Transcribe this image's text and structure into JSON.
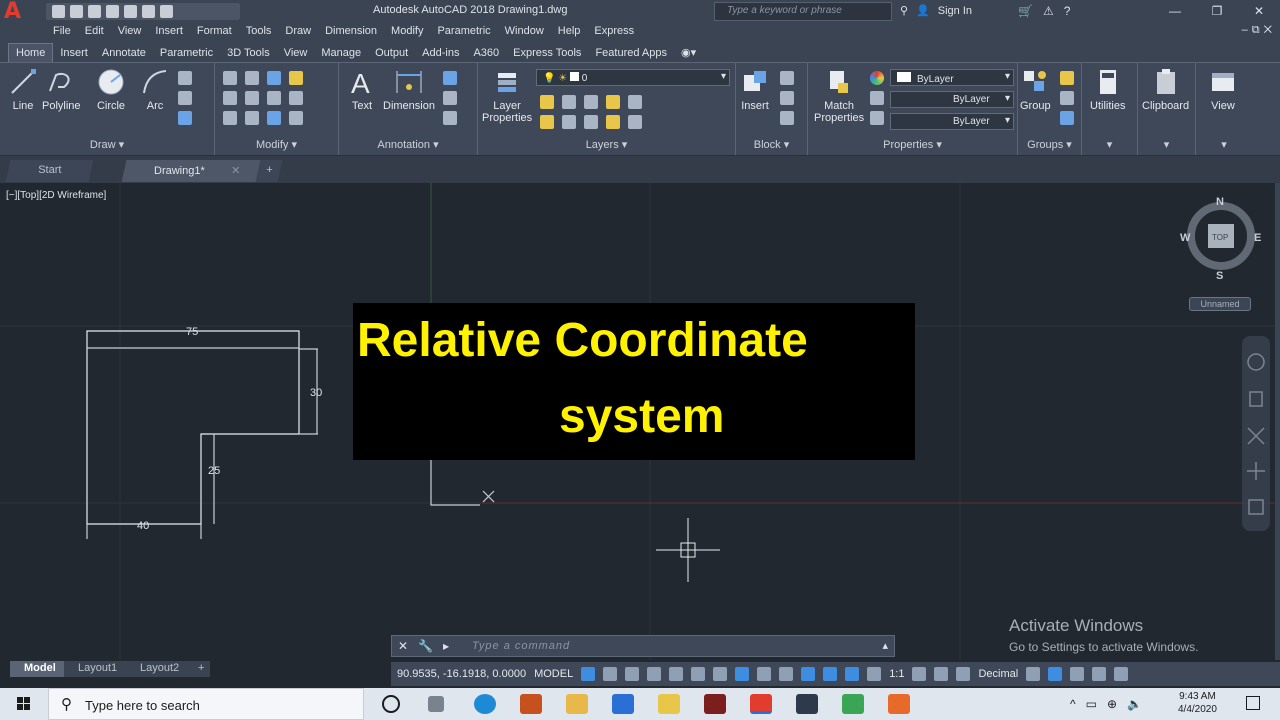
{
  "app": {
    "logo_letter": "A",
    "window_title": "Autodesk AutoCAD 2018    Drawing1.dwg",
    "search_placeholder": "Type a keyword or phrase",
    "sign_in": "Sign In"
  },
  "menu": [
    "File",
    "Edit",
    "View",
    "Insert",
    "Format",
    "Tools",
    "Draw",
    "Dimension",
    "Modify",
    "Parametric",
    "Window",
    "Help",
    "Express"
  ],
  "ribbon_tabs": [
    "Home",
    "Insert",
    "Annotate",
    "Parametric",
    "3D Tools",
    "View",
    "Manage",
    "Output",
    "Add-ins",
    "A360",
    "Express Tools",
    "Featured Apps"
  ],
  "ribbon": {
    "draw": {
      "title": "Draw",
      "line": "Line",
      "polyline": "Polyline",
      "circle": "Circle",
      "arc": "Arc"
    },
    "modify": {
      "title": "Modify"
    },
    "annotation": {
      "title": "Annotation",
      "text": "Text",
      "dimension": "Dimension"
    },
    "layers": {
      "title": "Layers",
      "layer_properties_1": "Layer",
      "layer_properties_2": "Properties",
      "current_layer": "0"
    },
    "block": {
      "title": "Block",
      "insert": "Insert"
    },
    "properties": {
      "title": "Properties",
      "match_1": "Match",
      "match_2": "Properties",
      "color": "ByLayer",
      "linetype": "ByLayer",
      "lineweight": "ByLayer"
    },
    "groups": {
      "title": "Groups",
      "group": "Group"
    },
    "utilities": "Utilities",
    "clipboard": "Clipboard",
    "view": "View"
  },
  "file_tabs": {
    "start": "Start",
    "drawing": "Drawing1*"
  },
  "viewport_label": "[−][Top][2D Wireframe]",
  "dimensions": {
    "top": "75",
    "right": "30",
    "inner": "25",
    "bottom": "40"
  },
  "overlay": {
    "line1": "Relative  Coordinate",
    "line2": "system"
  },
  "viewcube": {
    "n": "N",
    "s": "S",
    "e": "E",
    "w": "W",
    "top": "TOP",
    "ucs": "Unnamed"
  },
  "activate": {
    "title": "Activate Windows",
    "subtitle": "Go to Settings to activate Windows."
  },
  "command": {
    "placeholder": "Type  a  command"
  },
  "layout_tabs": [
    "Model",
    "Layout1",
    "Layout2"
  ],
  "status": {
    "coords": "90.9535, -16.1918, 0.0000",
    "space": "MODEL",
    "scale": "1:1",
    "units": "Decimal"
  },
  "taskbar": {
    "search": "Type here to search",
    "time": "9:43 AM",
    "date": "4/4/2020"
  }
}
